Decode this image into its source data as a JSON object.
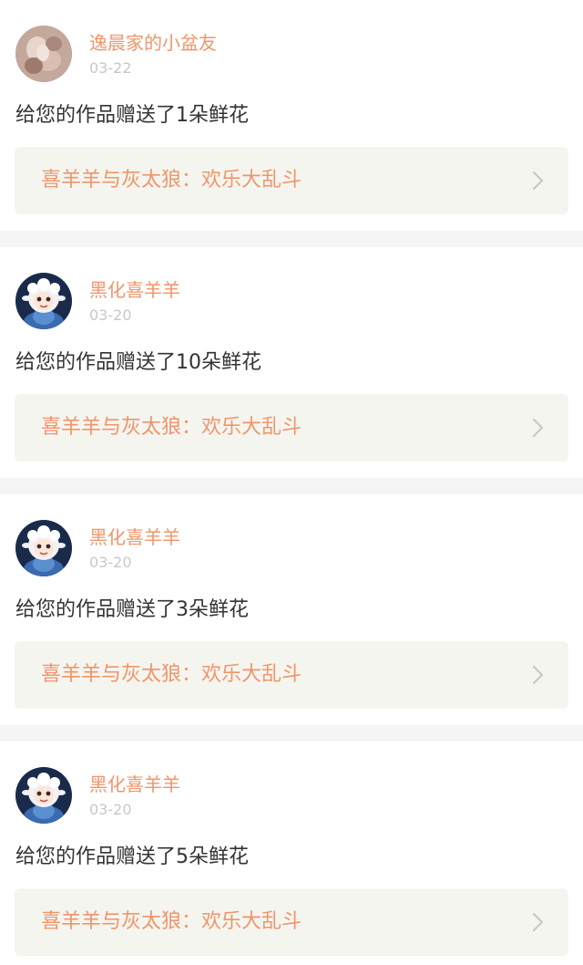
{
  "notifications": [
    {
      "username": "逸晨家的小盆友",
      "date": "03-22",
      "message": "给您的作品赠送了1朵鲜花",
      "work_title": "喜羊羊与灰太狼：欢乐大乱斗",
      "avatar_icon": "photo-avatar-icon"
    },
    {
      "username": "黑化喜羊羊",
      "date": "03-20",
      "message": "给您的作品赠送了10朵鲜花",
      "work_title": "喜羊羊与灰太狼：欢乐大乱斗",
      "avatar_icon": "sheep-avatar-icon"
    },
    {
      "username": "黑化喜羊羊",
      "date": "03-20",
      "message": "给您的作品赠送了3朵鲜花",
      "work_title": "喜羊羊与灰太狼：欢乐大乱斗",
      "avatar_icon": "sheep-avatar-icon"
    },
    {
      "username": "黑化喜羊羊",
      "date": "03-20",
      "message": "给您的作品赠送了5朵鲜花",
      "work_title": "喜羊羊与灰太狼：欢乐大乱斗",
      "avatar_icon": "sheep-avatar-icon"
    }
  ],
  "colors": {
    "accent": "#f0956a",
    "text": "#333333",
    "muted": "#c8c8c8",
    "card_bg": "#ffffff",
    "link_bg": "#f5f5f0",
    "page_bg": "#f6f5f5"
  }
}
